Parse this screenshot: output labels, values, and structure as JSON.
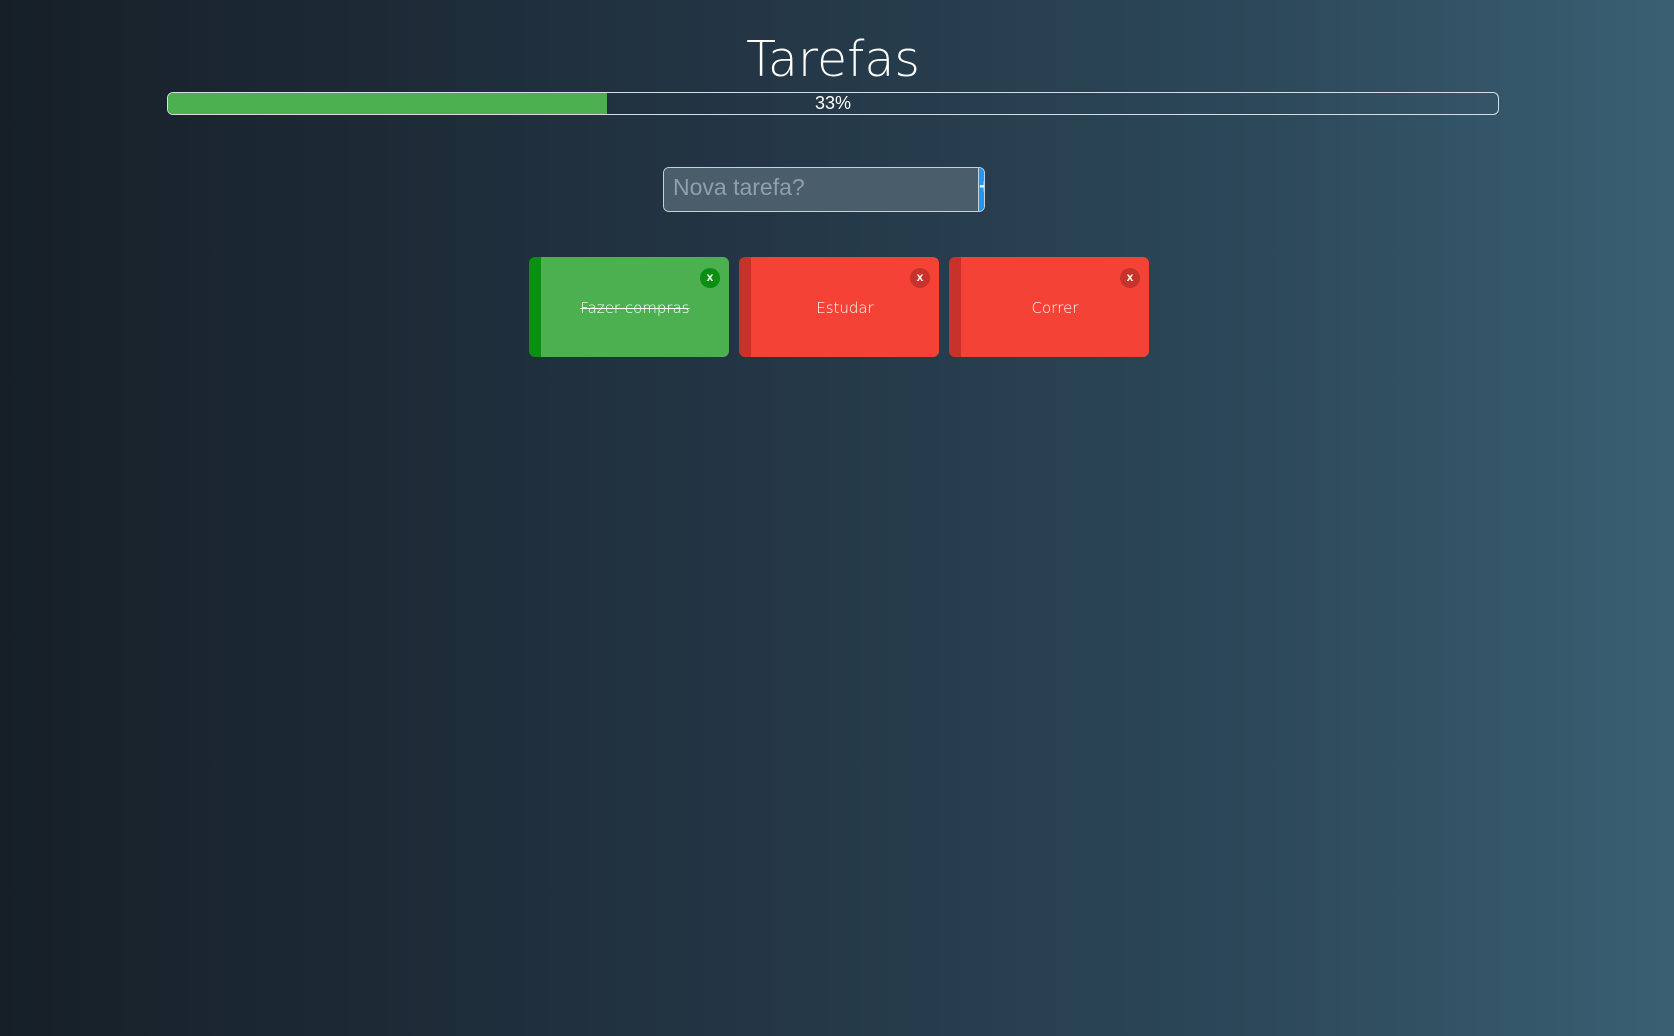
{
  "app": {
    "title": "Tarefas"
  },
  "progress": {
    "percent": 33,
    "label": "33%",
    "fill_color": "#4caf50"
  },
  "new_task": {
    "placeholder": "Nova tarefa?",
    "value": "",
    "add_label": "+"
  },
  "tasks": [
    {
      "label": "Fazer compras",
      "status": "done",
      "close_label": "x",
      "color": "#4caf50"
    },
    {
      "label": "Estudar",
      "status": "pending",
      "close_label": "x",
      "color": "#f44336"
    },
    {
      "label": "Correr",
      "status": "pending",
      "close_label": "x",
      "color": "#f44336"
    }
  ],
  "colors": {
    "add_button": "#2196f3",
    "done_accent": "#0a8f12",
    "pending_accent": "#c7322b"
  }
}
